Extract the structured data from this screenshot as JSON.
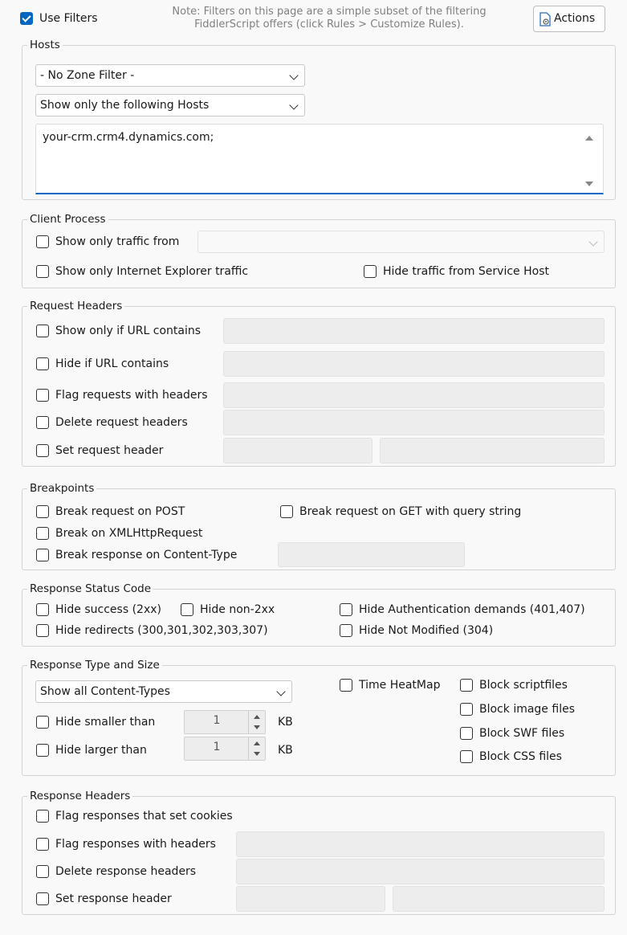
{
  "top": {
    "use_filters_label": "Use Filters",
    "use_filters_checked": true,
    "note_line1": "Note: Filters on this page are a simple subset of the filtering",
    "note_line2": "FiddlerScript offers (click Rules > Customize Rules).",
    "actions_label": "Actions"
  },
  "hosts": {
    "title": "Hosts",
    "zone_filter": "- No Zone Filter -",
    "host_filter": "Show only the following Hosts",
    "hosts_text": "your-crm.crm4.dynamics.com;"
  },
  "client_process": {
    "title": "Client Process",
    "show_only_from": "Show only traffic from",
    "show_only_ie": "Show only Internet Explorer traffic",
    "hide_service_host": "Hide traffic from Service Host"
  },
  "request_headers": {
    "title": "Request Headers",
    "show_if_url_contains": "Show only if URL contains",
    "hide_if_url_contains": "Hide if URL contains",
    "flag_requests_with_headers": "Flag requests with headers",
    "delete_request_headers": "Delete request headers",
    "set_request_header": "Set request header"
  },
  "breakpoints": {
    "title": "Breakpoints",
    "break_on_post": "Break request on POST",
    "break_on_get_query": "Break request on GET with query string",
    "break_on_xhr": "Break on XMLHttpRequest",
    "break_response_content_type": "Break response on Content-Type"
  },
  "response_status": {
    "title": "Response Status Code",
    "hide_success": "Hide success (2xx)",
    "hide_non_2xx": "Hide non-2xx",
    "hide_auth_demands": "Hide Authentication demands (401,407)",
    "hide_redirects": "Hide redirects (300,301,302,303,307)",
    "hide_not_modified": "Hide Not Modified (304)"
  },
  "response_type": {
    "title": "Response Type and Size",
    "content_type_filter": "Show all Content-Types",
    "time_heatmap": "Time HeatMap",
    "block_script": "Block scriptfiles",
    "block_image": "Block image files",
    "block_swf": "Block SWF files",
    "block_css": "Block CSS files",
    "hide_smaller": "Hide smaller than",
    "hide_larger": "Hide larger than",
    "smaller_value": "1",
    "larger_value": "1",
    "unit": "KB"
  },
  "response_headers": {
    "title": "Response Headers",
    "flag_set_cookies": "Flag responses that set cookies",
    "flag_with_headers": "Flag responses with headers",
    "delete_headers": "Delete response headers",
    "set_header": "Set response header"
  },
  "colors": {
    "accent": "#0067c0",
    "background": "#f9f9f9",
    "disabled_field": "#ededed"
  }
}
